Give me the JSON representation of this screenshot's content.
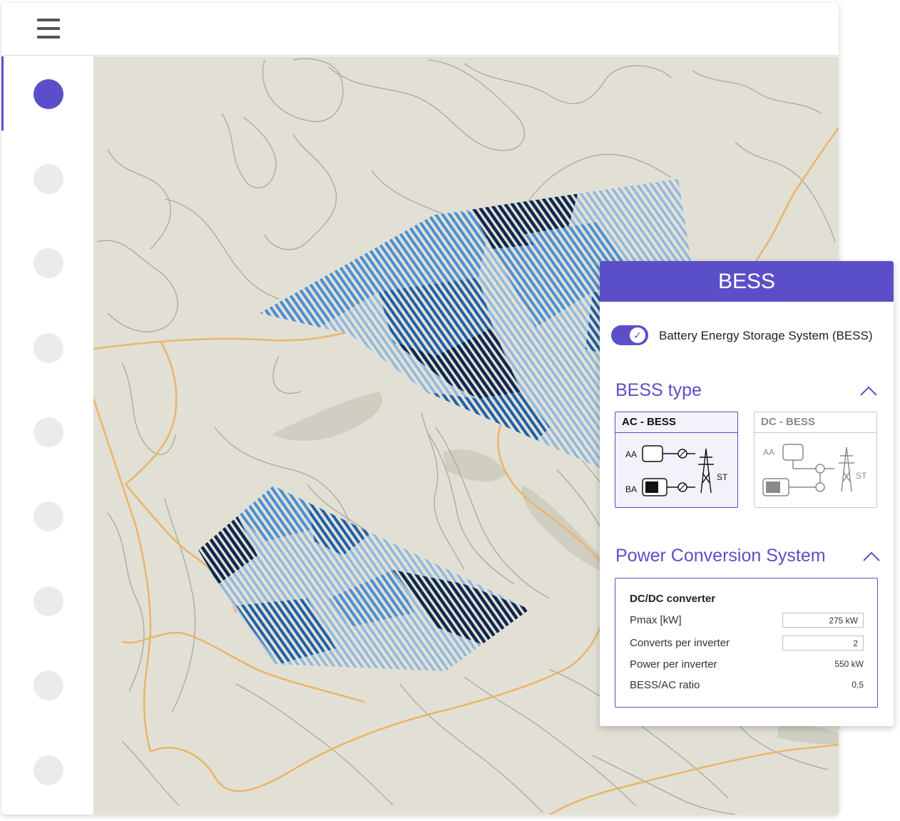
{
  "panel": {
    "title": "BESS",
    "toggle": {
      "label": "Battery Energy Storage System (BESS)",
      "on": true
    },
    "bess_type": {
      "title": "BESS type",
      "options": [
        {
          "label": "AC - BESS",
          "selected": true,
          "labels": [
            "AA",
            "BA",
            "ST"
          ]
        },
        {
          "label": "DC - BESS",
          "selected": false,
          "labels": [
            "AA",
            "ST"
          ]
        }
      ]
    },
    "pcs": {
      "title": "Power Conversion System",
      "subtitle": "DC/DC converter",
      "rows": [
        {
          "label": "Pmax [kW]",
          "value": "275 kW",
          "editable": true
        },
        {
          "label": "Converts per inverter",
          "value": "2",
          "editable": true
        },
        {
          "label": "Power per inverter",
          "value": "550 kW",
          "editable": false
        },
        {
          "label": "BESS/AC ratio",
          "value": "0,5",
          "editable": false
        }
      ]
    }
  },
  "icons": {
    "menu": "hamburger-icon",
    "chevron": "chevron-up-icon",
    "check": "check-icon"
  },
  "colors": {
    "accent": "#5b4fc9",
    "map_bg": "#e2e0d5",
    "road": "#e8b66c",
    "contour": "#a8a89e",
    "blue_light": "#8fb8e0",
    "blue_mid": "#4a8fd4",
    "blue_deep": "#1e5fa8",
    "blue_navy": "#0e2850"
  }
}
